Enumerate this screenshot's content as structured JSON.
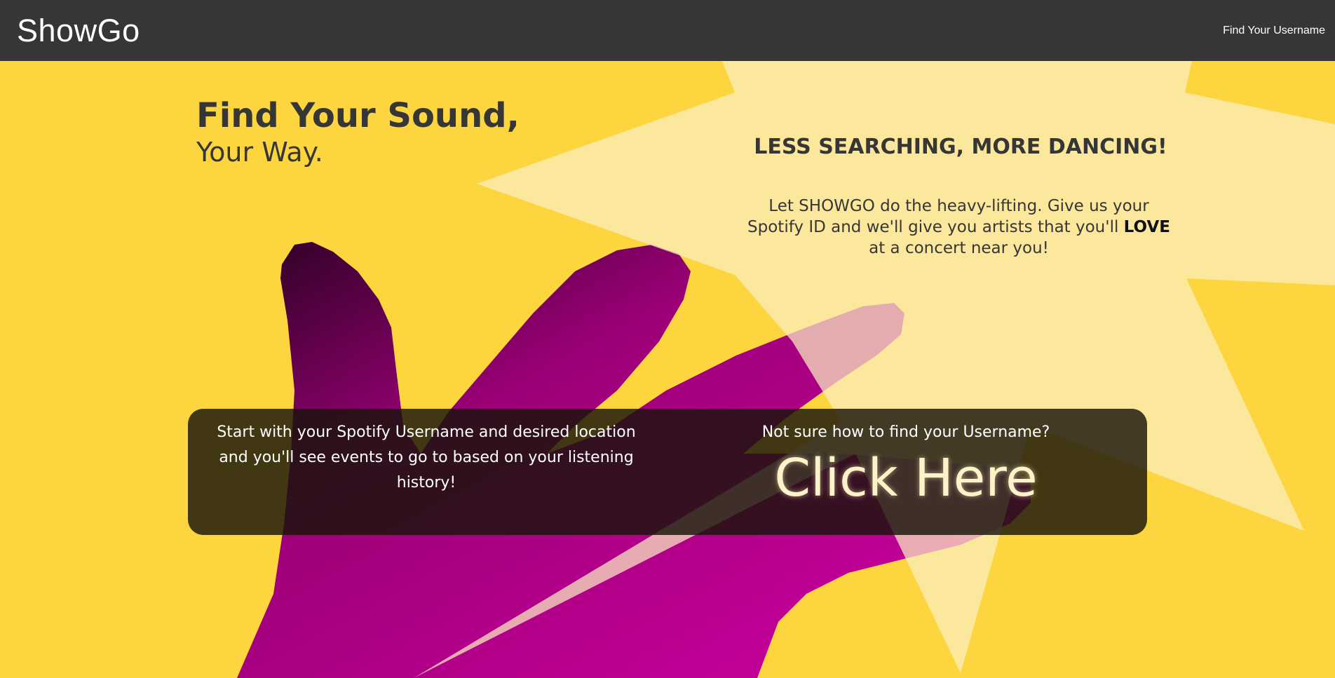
{
  "nav": {
    "brand": "ShowGo",
    "find_username_link": "Find Your Username"
  },
  "hero": {
    "headline_main": "Find Your Sound,",
    "headline_sub": "Your Way.",
    "tagline": "LESS SEARCHING, MORE DANCING!",
    "pitch_before": "Let SHOWGO do the heavy-lifting. Give us your Spotify ID and we'll give you artists that you'll ",
    "pitch_emphasis": "LOVE",
    "pitch_after": " at a concert near you!"
  },
  "cta": {
    "intro": "Start with your Spotify Username and desired location and you'll see events to go to based on your listening history!",
    "help_text": "Not sure how to find your Username?",
    "click_here": "Click Here"
  },
  "colors": {
    "navbar": "#363636",
    "background": "#fdd63f",
    "starburst": "#f6e49b",
    "hand": "#c6009a",
    "panel": "#19140a"
  }
}
